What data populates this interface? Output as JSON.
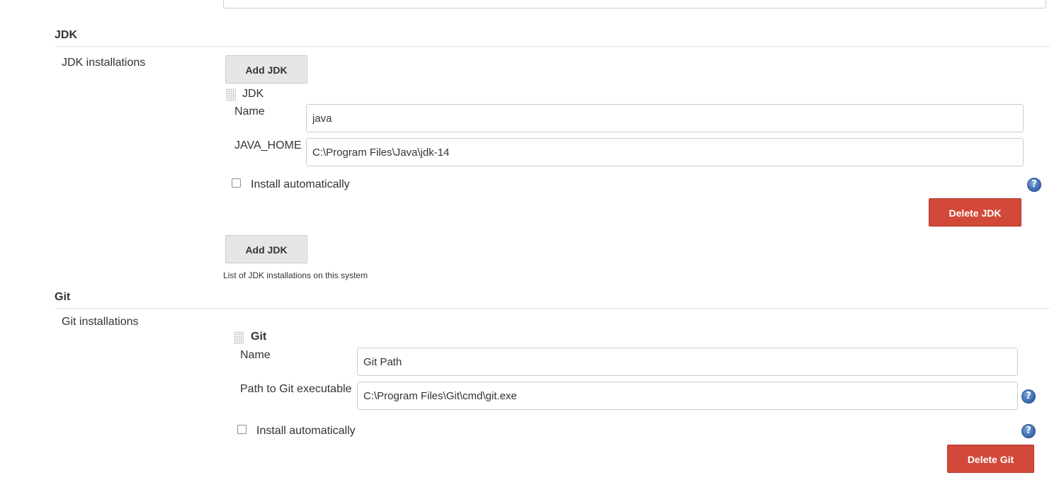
{
  "jdk": {
    "section_title": "JDK",
    "setting_label": "JDK installations",
    "add_button_top": "Add JDK",
    "item_title": "JDK",
    "name_label": "Name",
    "name_value": "java",
    "home_label": "JAVA_HOME",
    "home_value": "C:\\Program Files\\Java\\jdk-14",
    "install_auto_label": "Install automatically",
    "install_auto_checked": false,
    "delete_button": "Delete JDK",
    "add_button_bottom": "Add JDK",
    "help_text": "List of JDK installations on this system"
  },
  "git": {
    "section_title": "Git",
    "setting_label": "Git installations",
    "item_title": "Git",
    "name_label": "Name",
    "name_value": "Git Path",
    "path_label": "Path to Git executable",
    "path_value": "C:\\Program Files\\Git\\cmd\\git.exe",
    "install_auto_label": "Install automatically",
    "install_auto_checked": false,
    "delete_button": "Delete Git"
  },
  "icons": {
    "help": "help-icon",
    "grip": "drag-handle-icon"
  },
  "help_glyph": "?",
  "colors": {
    "delete_button_bg": "#d24939",
    "grey_button_bg": "#e6e6e6",
    "help_icon": "#3e6db3"
  }
}
